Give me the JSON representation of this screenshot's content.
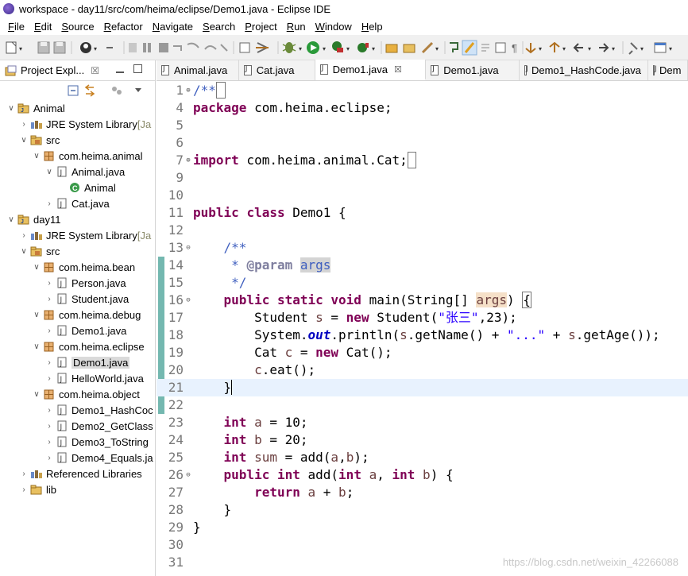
{
  "window": {
    "title": "workspace - day11/src/com/heima/eclipse/Demo1.java - Eclipse IDE"
  },
  "menu": [
    "File",
    "Edit",
    "Source",
    "Refactor",
    "Navigate",
    "Search",
    "Project",
    "Run",
    "Window",
    "Help"
  ],
  "explorer": {
    "title": "Project Expl...",
    "close_glyph": "☒",
    "tree": [
      {
        "depth": 0,
        "chev": "∨",
        "icon": "project-icon",
        "label": "Animal"
      },
      {
        "depth": 1,
        "chev": "›",
        "icon": "library-icon",
        "label": "JRE System Library",
        "suffix": "[Ja"
      },
      {
        "depth": 1,
        "chev": "∨",
        "icon": "source-folder-icon",
        "label": "src"
      },
      {
        "depth": 2,
        "chev": "∨",
        "icon": "package-icon",
        "label": "com.heima.animal"
      },
      {
        "depth": 3,
        "chev": "∨",
        "icon": "java-file-icon",
        "label": "Animal.java"
      },
      {
        "depth": 4,
        "chev": "",
        "icon": "class-icon",
        "label": "Animal"
      },
      {
        "depth": 3,
        "chev": "›",
        "icon": "java-file-icon",
        "label": "Cat.java"
      },
      {
        "depth": 0,
        "chev": "∨",
        "icon": "project-icon",
        "label": "day11"
      },
      {
        "depth": 1,
        "chev": "›",
        "icon": "library-icon",
        "label": "JRE System Library",
        "suffix": "[Ja"
      },
      {
        "depth": 1,
        "chev": "∨",
        "icon": "source-folder-icon",
        "label": "src"
      },
      {
        "depth": 2,
        "chev": "∨",
        "icon": "package-icon",
        "label": "com.heima.bean"
      },
      {
        "depth": 3,
        "chev": "›",
        "icon": "java-file-icon",
        "label": "Person.java"
      },
      {
        "depth": 3,
        "chev": "›",
        "icon": "java-file-icon",
        "label": "Student.java"
      },
      {
        "depth": 2,
        "chev": "∨",
        "icon": "package-icon",
        "label": "com.heima.debug"
      },
      {
        "depth": 3,
        "chev": "›",
        "icon": "java-file-icon",
        "label": "Demo1.java"
      },
      {
        "depth": 2,
        "chev": "∨",
        "icon": "package-icon",
        "label": "com.heima.eclipse"
      },
      {
        "depth": 3,
        "chev": "›",
        "icon": "java-file-icon",
        "label": "Demo1.java",
        "selected": true
      },
      {
        "depth": 3,
        "chev": "›",
        "icon": "java-file-icon",
        "label": "HelloWorld.java"
      },
      {
        "depth": 2,
        "chev": "∨",
        "icon": "package-icon",
        "label": "com.heima.object"
      },
      {
        "depth": 3,
        "chev": "›",
        "icon": "java-file-icon",
        "label": "Demo1_HashCoc"
      },
      {
        "depth": 3,
        "chev": "›",
        "icon": "java-file-icon",
        "label": "Demo2_GetClass"
      },
      {
        "depth": 3,
        "chev": "›",
        "icon": "java-file-icon",
        "label": "Demo3_ToString"
      },
      {
        "depth": 3,
        "chev": "›",
        "icon": "java-file-icon",
        "label": "Demo4_Equals.ja"
      },
      {
        "depth": 1,
        "chev": "›",
        "icon": "library-icon",
        "label": "Referenced Libraries"
      },
      {
        "depth": 1,
        "chev": "›",
        "icon": "folder-icon",
        "label": "lib"
      }
    ]
  },
  "tabs": [
    {
      "label": "Animal.java",
      "active": false
    },
    {
      "label": "Cat.java",
      "active": false
    },
    {
      "label": "Demo1.java",
      "active": true,
      "close": "☒"
    },
    {
      "label": "Demo1.java",
      "active": false
    },
    {
      "label": "Demo1_HashCode.java",
      "active": false
    },
    {
      "label": "Dem",
      "active": false
    }
  ],
  "code": [
    {
      "n": "1",
      "fold": "⊕",
      "segs": [
        [
          "jd",
          "/**"
        ],
        [
          "box",
          " "
        ]
      ]
    },
    {
      "n": "4",
      "segs": [
        [
          "kw",
          "package"
        ],
        [
          "",
          " com.heima.eclipse;"
        ]
      ]
    },
    {
      "n": "5",
      "segs": []
    },
    {
      "n": "6",
      "segs": []
    },
    {
      "n": "7",
      "fold": "⊕",
      "segs": [
        [
          "kw",
          "import"
        ],
        [
          "",
          " com.heima.animal.Cat;"
        ],
        [
          "box",
          " "
        ]
      ]
    },
    {
      "n": "9",
      "segs": []
    },
    {
      "n": "10",
      "segs": []
    },
    {
      "n": "11",
      "segs": [
        [
          "kw",
          "public"
        ],
        [
          "",
          " "
        ],
        [
          "kw",
          "class"
        ],
        [
          "",
          " Demo1 {"
        ]
      ]
    },
    {
      "n": "12",
      "segs": []
    },
    {
      "n": "13",
      "fold": "⊖",
      "segs": [
        [
          "",
          "    "
        ],
        [
          "jd",
          "/**"
        ]
      ]
    },
    {
      "n": "14",
      "segs": [
        [
          "",
          "     "
        ],
        [
          "jd",
          "* "
        ],
        [
          "jt",
          "@param"
        ],
        [
          "jd",
          " "
        ],
        [
          "jdhl",
          "args"
        ]
      ]
    },
    {
      "n": "15",
      "segs": [
        [
          "",
          "     "
        ],
        [
          "jd",
          "*/"
        ]
      ]
    },
    {
      "n": "16",
      "fold": "⊖",
      "segs": [
        [
          "",
          "    "
        ],
        [
          "kw",
          "public"
        ],
        [
          "",
          " "
        ],
        [
          "kw",
          "static"
        ],
        [
          "",
          " "
        ],
        [
          "kw",
          "void"
        ],
        [
          "",
          " main(String[] "
        ],
        [
          "varhl",
          "args"
        ],
        [
          "",
          ") "
        ],
        [
          "box",
          "{"
        ]
      ]
    },
    {
      "n": "17",
      "segs": [
        [
          "",
          "        Student "
        ],
        [
          "var",
          "s"
        ],
        [
          "",
          " = "
        ],
        [
          "kw",
          "new"
        ],
        [
          "",
          " Student("
        ],
        [
          "str",
          "\"张三\""
        ],
        [
          "",
          ",23);"
        ]
      ]
    },
    {
      "n": "18",
      "segs": [
        [
          "",
          "        System."
        ],
        [
          "fld",
          "out"
        ],
        [
          "",
          ".println("
        ],
        [
          "var",
          "s"
        ],
        [
          "",
          ".getName() + "
        ],
        [
          "str",
          "\"...\""
        ],
        [
          "",
          " + "
        ],
        [
          "var",
          "s"
        ],
        [
          "",
          ".getAge());"
        ]
      ]
    },
    {
      "n": "19",
      "segs": [
        [
          "",
          "        Cat "
        ],
        [
          "var",
          "c"
        ],
        [
          "",
          " = "
        ],
        [
          "kw",
          "new"
        ],
        [
          "",
          " Cat();"
        ]
      ]
    },
    {
      "n": "20",
      "segs": [
        [
          "",
          "        "
        ],
        [
          "var",
          "c"
        ],
        [
          "",
          ".eat();"
        ]
      ]
    },
    {
      "n": "21",
      "current": true,
      "segs": [
        [
          "",
          "    }"
        ]
      ]
    },
    {
      "n": "22",
      "segs": []
    },
    {
      "n": "23",
      "segs": [
        [
          "",
          "    "
        ],
        [
          "kw",
          "int"
        ],
        [
          "",
          " "
        ],
        [
          "fldn",
          "a"
        ],
        [
          "",
          " = 10;"
        ]
      ]
    },
    {
      "n": "24",
      "segs": [
        [
          "",
          "    "
        ],
        [
          "kw",
          "int"
        ],
        [
          "",
          " "
        ],
        [
          "fldn",
          "b"
        ],
        [
          "",
          " = 20;"
        ]
      ]
    },
    {
      "n": "25",
      "segs": [
        [
          "",
          "    "
        ],
        [
          "kw",
          "int"
        ],
        [
          "",
          " "
        ],
        [
          "fldn",
          "sum"
        ],
        [
          "",
          " = add("
        ],
        [
          "fldn",
          "a"
        ],
        [
          "",
          ","
        ],
        [
          "fldn",
          "b"
        ],
        [
          "",
          ");"
        ]
      ]
    },
    {
      "n": "26",
      "fold": "⊖",
      "segs": [
        [
          "",
          "    "
        ],
        [
          "kw",
          "public"
        ],
        [
          "",
          " "
        ],
        [
          "kw",
          "int"
        ],
        [
          "",
          " add("
        ],
        [
          "kw",
          "int"
        ],
        [
          "",
          " "
        ],
        [
          "var",
          "a"
        ],
        [
          "",
          ", "
        ],
        [
          "kw",
          "int"
        ],
        [
          "",
          " "
        ],
        [
          "var",
          "b"
        ],
        [
          "",
          ") {"
        ]
      ]
    },
    {
      "n": "27",
      "segs": [
        [
          "",
          "        "
        ],
        [
          "kw",
          "return"
        ],
        [
          "",
          " "
        ],
        [
          "var",
          "a"
        ],
        [
          "",
          " + "
        ],
        [
          "var",
          "b"
        ],
        [
          "",
          ";"
        ]
      ]
    },
    {
      "n": "28",
      "segs": [
        [
          "",
          "    }"
        ]
      ]
    },
    {
      "n": "29",
      "segs": [
        [
          "",
          "}"
        ]
      ]
    },
    {
      "n": "30",
      "segs": []
    },
    {
      "n": "31",
      "segs": []
    }
  ],
  "watermark": "https://blog.csdn.net/weixin_42266088"
}
